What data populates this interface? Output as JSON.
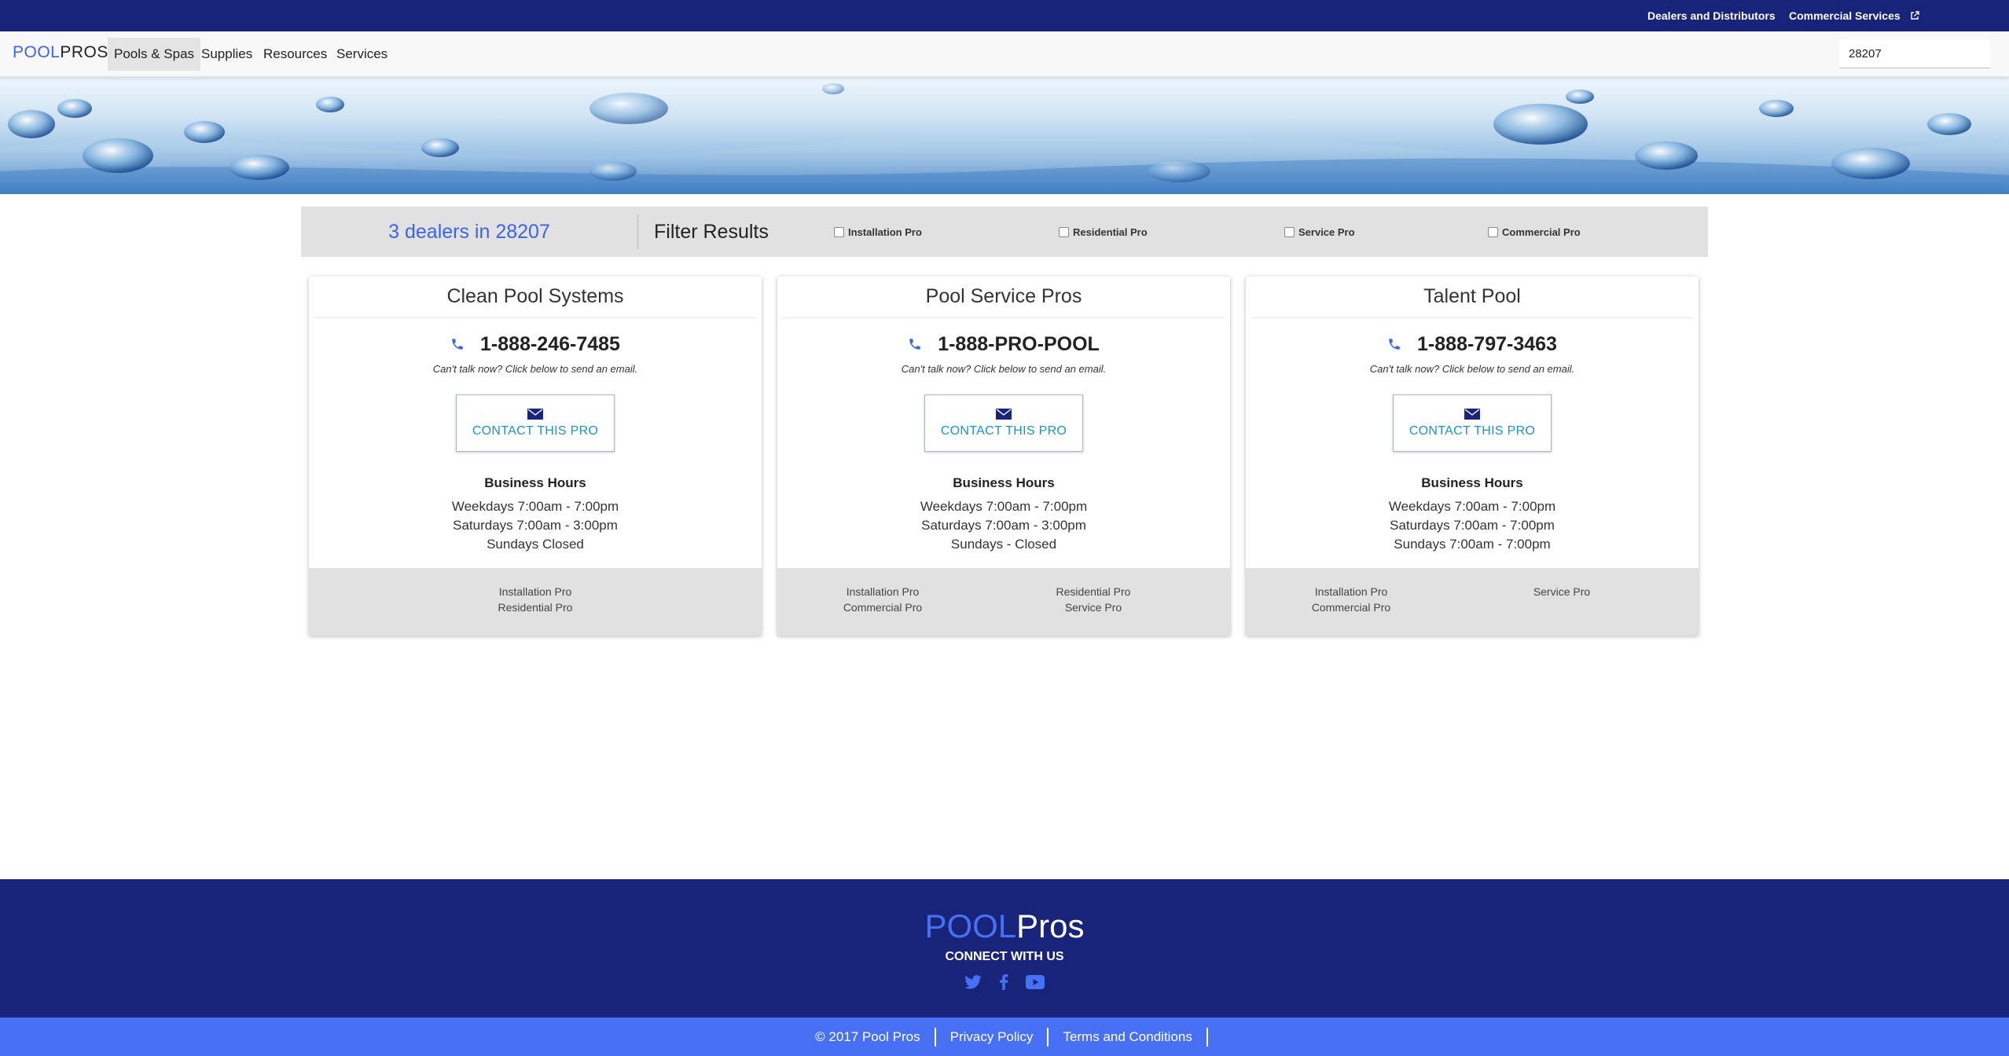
{
  "utility": {
    "dealers_label": "Dealers and Distributors",
    "commercial_label": "Commercial Services"
  },
  "nav": {
    "logo_pool": "POOL",
    "logo_pros": "PROS",
    "items": [
      {
        "label": "Pools & Spas",
        "active": true
      },
      {
        "label": "Supplies"
      },
      {
        "label": "Resources"
      },
      {
        "label": "Services"
      }
    ],
    "zip_value": "28207"
  },
  "results": {
    "count_text": "3 dealers in 28207",
    "filter_title": "Filter Results",
    "filters": [
      {
        "label": "Installation Pro",
        "checked": false
      },
      {
        "label": "Residential Pro",
        "checked": false
      },
      {
        "label": "Service Pro",
        "checked": false
      },
      {
        "label": "Commercial Pro",
        "checked": false
      }
    ]
  },
  "dealers": [
    {
      "name": "Clean Pool Systems",
      "phone": "1-888-246-7485",
      "prompt": "Can't talk now? Click below to send an email.",
      "contact_label": "CONTACT THIS PRO",
      "hours_title": "Business Hours",
      "hours": [
        "Weekdays 7:00am - 7:00pm",
        "Saturdays 7:00am - 3:00pm",
        "Sundays Closed"
      ],
      "tags": [
        "Installation Pro",
        "Residential Pro"
      ]
    },
    {
      "name": "Pool Service Pros",
      "phone": "1-888-PRO-POOL",
      "prompt": "Can't talk now? Click below to send an email.",
      "contact_label": "CONTACT THIS PRO",
      "hours_title": "Business Hours",
      "hours": [
        "Weekdays 7:00am - 7:00pm",
        "Saturdays 7:00am - 3:00pm",
        "Sundays - Closed"
      ],
      "tags": [
        "Installation Pro",
        "Commercial Pro",
        "Residential Pro",
        "Service Pro"
      ]
    },
    {
      "name": "Talent Pool",
      "phone": "1-888-797-3463",
      "prompt": "Can't talk now? Click below to send an email.",
      "contact_label": "CONTACT THIS PRO",
      "hours_title": "Business Hours",
      "hours": [
        "Weekdays 7:00am - 7:00pm",
        "Saturdays 7:00am - 7:00pm",
        "Sundays 7:00am - 7:00pm"
      ],
      "tags": [
        "Installation Pro",
        "Commercial Pro",
        "Service Pro"
      ]
    }
  ],
  "footer": {
    "logo_pool": "POOL",
    "logo_pros": "Pros",
    "connect_label": "CONNECT WITH US",
    "social_icons": [
      "twitter-icon",
      "facebook-icon",
      "youtube-icon"
    ],
    "links": [
      "© 2017 Pool Pros",
      "Privacy Policy",
      "Terms and Conditions"
    ]
  },
  "colors": {
    "navy": "#17247a",
    "accent_blue": "#3e63e6",
    "bottom_bar": "#4870f5",
    "contact_text": "#1d92c0",
    "panel_gray": "#e1e1e1"
  }
}
